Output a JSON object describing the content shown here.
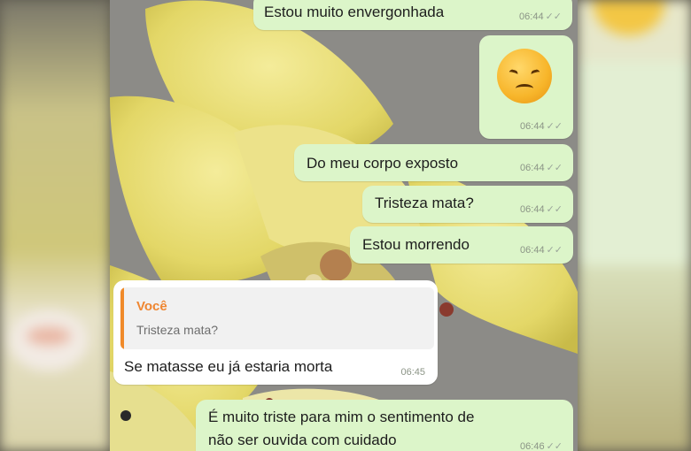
{
  "messages": [
    {
      "text": "Estou muito envergonhada",
      "time": "06:44",
      "direction": "outgoing"
    },
    {
      "emoji": "disappointed-face",
      "time": "06:44",
      "direction": "outgoing"
    },
    {
      "text": "Do meu corpo exposto",
      "time": "06:44",
      "direction": "outgoing"
    },
    {
      "text": "Tristeza mata?",
      "time": "06:44",
      "direction": "outgoing"
    },
    {
      "text": "Estou morrendo",
      "time": "06:44",
      "direction": "outgoing"
    },
    {
      "reply_to": {
        "author": "Você",
        "text": "Tristeza mata?"
      },
      "text": "Se matasse eu já estaria morta",
      "time": "06:45",
      "direction": "incoming"
    },
    {
      "text_line1": "É muito triste para mim o sentimento de",
      "text_line2": "não ser ouvida com cuidado",
      "time": "06:46",
      "direction": "outgoing"
    }
  ],
  "colors": {
    "outgoing_bubble": "#dcf5c9",
    "incoming_bubble": "#ffffff",
    "quote_accent": "#ef8631"
  },
  "icons": {
    "read_receipt": "double-check-icon"
  }
}
